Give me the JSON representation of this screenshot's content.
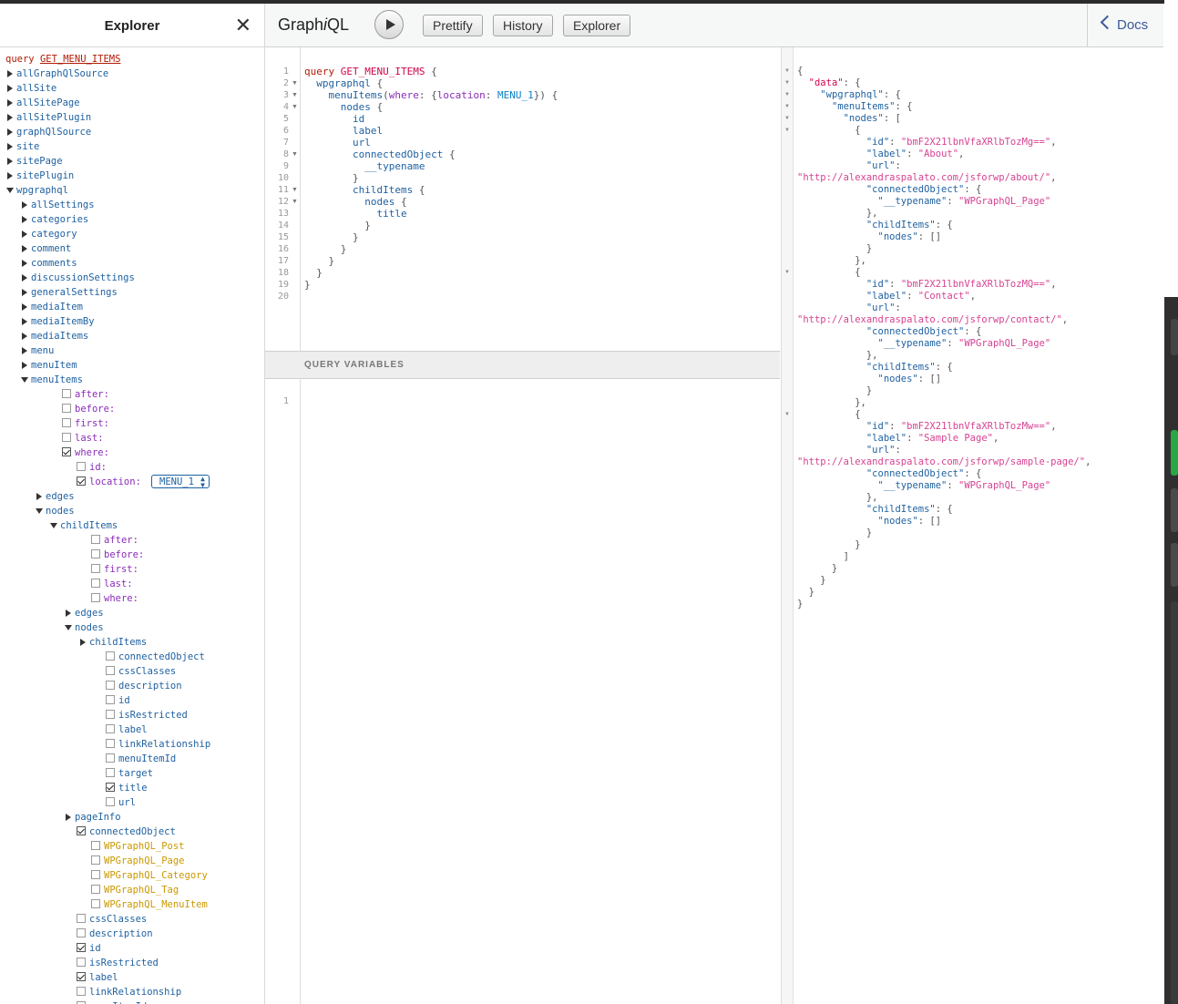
{
  "explorer": {
    "title": "Explorer",
    "query_keyword": "query",
    "operation_name": "GET_MENU_ITEMS",
    "tree": [
      {
        "label": "allGraphQlSource",
        "kind": "field",
        "ctrl": "arrow-right",
        "depth": 0
      },
      {
        "label": "allSite",
        "kind": "field",
        "ctrl": "arrow-right",
        "depth": 0
      },
      {
        "label": "allSitePage",
        "kind": "field",
        "ctrl": "arrow-right",
        "depth": 0
      },
      {
        "label": "allSitePlugin",
        "kind": "field",
        "ctrl": "arrow-right",
        "depth": 0
      },
      {
        "label": "graphQlSource",
        "kind": "field",
        "ctrl": "arrow-right",
        "depth": 0
      },
      {
        "label": "site",
        "kind": "field",
        "ctrl": "arrow-right",
        "depth": 0
      },
      {
        "label": "sitePage",
        "kind": "field",
        "ctrl": "arrow-right",
        "depth": 0
      },
      {
        "label": "sitePlugin",
        "kind": "field",
        "ctrl": "arrow-right",
        "depth": 0
      },
      {
        "label": "wpgraphql",
        "kind": "field",
        "ctrl": "arrow-down",
        "depth": 0
      },
      {
        "label": "allSettings",
        "kind": "field",
        "ctrl": "arrow-right",
        "depth": 1
      },
      {
        "label": "categories",
        "kind": "field",
        "ctrl": "arrow-right",
        "depth": 1
      },
      {
        "label": "category",
        "kind": "field",
        "ctrl": "arrow-right",
        "depth": 1
      },
      {
        "label": "comment",
        "kind": "field",
        "ctrl": "arrow-right",
        "depth": 1
      },
      {
        "label": "comments",
        "kind": "field",
        "ctrl": "arrow-right",
        "depth": 1
      },
      {
        "label": "discussionSettings",
        "kind": "field",
        "ctrl": "arrow-right",
        "depth": 1
      },
      {
        "label": "generalSettings",
        "kind": "field",
        "ctrl": "arrow-right",
        "depth": 1
      },
      {
        "label": "mediaItem",
        "kind": "field",
        "ctrl": "arrow-right",
        "depth": 1
      },
      {
        "label": "mediaItemBy",
        "kind": "field",
        "ctrl": "arrow-right",
        "depth": 1
      },
      {
        "label": "mediaItems",
        "kind": "field",
        "ctrl": "arrow-right",
        "depth": 1
      },
      {
        "label": "menu",
        "kind": "field",
        "ctrl": "arrow-right",
        "depth": 1
      },
      {
        "label": "menuItem",
        "kind": "field",
        "ctrl": "arrow-right",
        "depth": 1
      },
      {
        "label": "menuItems",
        "kind": "field",
        "ctrl": "arrow-down",
        "depth": 1
      },
      {
        "label": "after:",
        "kind": "arg",
        "ctrl": "cb",
        "depth": 2
      },
      {
        "label": "before:",
        "kind": "arg",
        "ctrl": "cb",
        "depth": 2
      },
      {
        "label": "first:",
        "kind": "arg",
        "ctrl": "cb",
        "depth": 2
      },
      {
        "label": "last:",
        "kind": "arg",
        "ctrl": "cb",
        "depth": 2
      },
      {
        "label": "where:",
        "kind": "arg",
        "ctrl": "cb-checked",
        "depth": 2
      },
      {
        "label": "id:",
        "kind": "arg",
        "ctrl": "cb",
        "depth": 3
      },
      {
        "label": "location:",
        "kind": "arg",
        "ctrl": "cb-checked",
        "depth": 3,
        "select": "MENU_1"
      },
      {
        "label": "edges",
        "kind": "field",
        "ctrl": "arrow-right",
        "depth": 2
      },
      {
        "label": "nodes",
        "kind": "field",
        "ctrl": "arrow-down",
        "depth": 2
      },
      {
        "label": "childItems",
        "kind": "field",
        "ctrl": "arrow-down",
        "depth": 3
      },
      {
        "label": "after:",
        "kind": "arg",
        "ctrl": "cb",
        "depth": 4
      },
      {
        "label": "before:",
        "kind": "arg",
        "ctrl": "cb",
        "depth": 4
      },
      {
        "label": "first:",
        "kind": "arg",
        "ctrl": "cb",
        "depth": 4
      },
      {
        "label": "last:",
        "kind": "arg",
        "ctrl": "cb",
        "depth": 4
      },
      {
        "label": "where:",
        "kind": "arg",
        "ctrl": "cb",
        "depth": 4
      },
      {
        "label": "edges",
        "kind": "field",
        "ctrl": "arrow-right",
        "depth": 4
      },
      {
        "label": "nodes",
        "kind": "field",
        "ctrl": "arrow-down",
        "depth": 4
      },
      {
        "label": "childItems",
        "kind": "field",
        "ctrl": "arrow-right",
        "depth": 5
      },
      {
        "label": "connectedObject",
        "kind": "field",
        "ctrl": "cb",
        "depth": 5
      },
      {
        "label": "cssClasses",
        "kind": "field",
        "ctrl": "cb",
        "depth": 5
      },
      {
        "label": "description",
        "kind": "field",
        "ctrl": "cb",
        "depth": 5
      },
      {
        "label": "id",
        "kind": "field",
        "ctrl": "cb",
        "depth": 5
      },
      {
        "label": "isRestricted",
        "kind": "field",
        "ctrl": "cb",
        "depth": 5
      },
      {
        "label": "label",
        "kind": "field",
        "ctrl": "cb",
        "depth": 5
      },
      {
        "label": "linkRelationship",
        "kind": "field",
        "ctrl": "cb",
        "depth": 5
      },
      {
        "label": "menuItemId",
        "kind": "field",
        "ctrl": "cb",
        "depth": 5
      },
      {
        "label": "target",
        "kind": "field",
        "ctrl": "cb",
        "depth": 5
      },
      {
        "label": "title",
        "kind": "field",
        "ctrl": "cb-checked",
        "depth": 5
      },
      {
        "label": "url",
        "kind": "field",
        "ctrl": "cb",
        "depth": 5
      },
      {
        "label": "pageInfo",
        "kind": "field",
        "ctrl": "arrow-right",
        "depth": 4
      },
      {
        "label": "connectedObject",
        "kind": "field",
        "ctrl": "cb-checked",
        "depth": 3
      },
      {
        "label": "WPGraphQL_Post",
        "kind": "type",
        "ctrl": "cb",
        "depth": 4
      },
      {
        "label": "WPGraphQL_Page",
        "kind": "type",
        "ctrl": "cb",
        "depth": 4
      },
      {
        "label": "WPGraphQL_Category",
        "kind": "type",
        "ctrl": "cb",
        "depth": 4
      },
      {
        "label": "WPGraphQL_Tag",
        "kind": "type",
        "ctrl": "cb",
        "depth": 4
      },
      {
        "label": "WPGraphQL_MenuItem",
        "kind": "type",
        "ctrl": "cb",
        "depth": 4
      },
      {
        "label": "cssClasses",
        "kind": "field",
        "ctrl": "cb",
        "depth": 3
      },
      {
        "label": "description",
        "kind": "field",
        "ctrl": "cb",
        "depth": 3
      },
      {
        "label": "id",
        "kind": "field",
        "ctrl": "cb-checked",
        "depth": 3
      },
      {
        "label": "isRestricted",
        "kind": "field",
        "ctrl": "cb",
        "depth": 3
      },
      {
        "label": "label",
        "kind": "field",
        "ctrl": "cb-checked",
        "depth": 3
      },
      {
        "label": "linkRelationship",
        "kind": "field",
        "ctrl": "cb",
        "depth": 3
      },
      {
        "label": "menuItemId",
        "kind": "field",
        "ctrl": "cb",
        "depth": 3
      }
    ]
  },
  "toolbar": {
    "logo_pre": "Graph",
    "logo_i": "i",
    "logo_post": "QL",
    "prettify": "Prettify",
    "history": "History",
    "explorer": "Explorer",
    "docs": "Docs"
  },
  "editor": {
    "line_numbers": [
      "1",
      "2",
      "3",
      "4",
      "5",
      "6",
      "7",
      "8",
      "9",
      "10",
      "11",
      "12",
      "13",
      "14",
      "15",
      "16",
      "17",
      "18",
      "19",
      "20"
    ],
    "query_variables_label": "QUERY VARIABLES",
    "variables_line": "1",
    "code": [
      [
        [
          "c-kw",
          "query "
        ],
        [
          "c-def",
          "GET_MENU_ITEMS"
        ],
        [
          "c-p",
          " {"
        ]
      ],
      [
        [
          "c-p",
          "  "
        ],
        [
          "c-prop",
          "wpgraphql"
        ],
        [
          "c-p",
          " {"
        ]
      ],
      [
        [
          "c-p",
          "    "
        ],
        [
          "c-prop",
          "menuItems"
        ],
        [
          "c-p",
          "("
        ],
        [
          "c-attr",
          "where"
        ],
        [
          "c-p",
          ": {"
        ],
        [
          "c-attr",
          "location"
        ],
        [
          "c-p",
          ": "
        ],
        [
          "c-val",
          "MENU_1"
        ],
        [
          "c-p",
          "}) {"
        ]
      ],
      [
        [
          "c-p",
          "      "
        ],
        [
          "c-prop",
          "nodes"
        ],
        [
          "c-p",
          " {"
        ]
      ],
      [
        [
          "c-p",
          "        "
        ],
        [
          "c-prop",
          "id"
        ]
      ],
      [
        [
          "c-p",
          "        "
        ],
        [
          "c-prop",
          "label"
        ]
      ],
      [
        [
          "c-p",
          "        "
        ],
        [
          "c-prop",
          "url"
        ]
      ],
      [
        [
          "c-p",
          "        "
        ],
        [
          "c-prop",
          "connectedObject"
        ],
        [
          "c-p",
          " {"
        ]
      ],
      [
        [
          "c-p",
          "          "
        ],
        [
          "c-prop",
          "__typename"
        ]
      ],
      [
        [
          "c-p",
          "        }"
        ]
      ],
      [
        [
          "c-p",
          "        "
        ],
        [
          "c-prop",
          "childItems"
        ],
        [
          "c-p",
          " {"
        ]
      ],
      [
        [
          "c-p",
          "          "
        ],
        [
          "c-prop",
          "nodes"
        ],
        [
          "c-p",
          " {"
        ]
      ],
      [
        [
          "c-p",
          "            "
        ],
        [
          "c-prop",
          "title"
        ]
      ],
      [
        [
          "c-p",
          "          }"
        ]
      ],
      [
        [
          "c-p",
          "        }"
        ]
      ],
      [
        [
          "c-p",
          "      }"
        ]
      ],
      [
        [
          "c-p",
          "    }"
        ]
      ],
      [
        [
          "c-p",
          "  }"
        ]
      ],
      [
        [
          "c-p",
          "}"
        ]
      ],
      [
        [
          "c-p",
          ""
        ]
      ]
    ]
  },
  "result": {
    "lines": [
      [
        [
          "r-p",
          "{"
        ]
      ],
      [
        [
          "r-p",
          "  "
        ],
        [
          "r-dkey",
          "\"data\""
        ],
        [
          "r-p",
          ": {"
        ]
      ],
      [
        [
          "r-p",
          "    "
        ],
        [
          "r-key",
          "\"wpgraphql\""
        ],
        [
          "r-p",
          ": {"
        ]
      ],
      [
        [
          "r-p",
          "      "
        ],
        [
          "r-key",
          "\"menuItems\""
        ],
        [
          "r-p",
          ": {"
        ]
      ],
      [
        [
          "r-p",
          "        "
        ],
        [
          "r-key",
          "\"nodes\""
        ],
        [
          "r-p",
          ": ["
        ]
      ],
      [
        [
          "r-p",
          "          {"
        ]
      ],
      [
        [
          "r-p",
          "            "
        ],
        [
          "r-key",
          "\"id\""
        ],
        [
          "r-p",
          ": "
        ],
        [
          "r-str",
          "\"bmF2X21lbnVfaXRlbTozMg==\""
        ],
        [
          "r-p",
          ","
        ]
      ],
      [
        [
          "r-p",
          "            "
        ],
        [
          "r-key",
          "\"label\""
        ],
        [
          "r-p",
          ": "
        ],
        [
          "r-str",
          "\"About\""
        ],
        [
          "r-p",
          ","
        ]
      ],
      [
        [
          "r-p",
          "            "
        ],
        [
          "r-key",
          "\"url\""
        ],
        [
          "r-p",
          ":"
        ]
      ],
      [
        [
          "r-str",
          "\"http://alexandraspalato.com/jsforwp/about/\""
        ],
        [
          "r-p",
          ","
        ]
      ],
      [
        [
          "r-p",
          "            "
        ],
        [
          "r-key",
          "\"connectedObject\""
        ],
        [
          "r-p",
          ": {"
        ]
      ],
      [
        [
          "r-p",
          "              "
        ],
        [
          "r-key",
          "\"__typename\""
        ],
        [
          "r-p",
          ": "
        ],
        [
          "r-str",
          "\"WPGraphQL_Page\""
        ]
      ],
      [
        [
          "r-p",
          "            },"
        ]
      ],
      [
        [
          "r-p",
          "            "
        ],
        [
          "r-key",
          "\"childItems\""
        ],
        [
          "r-p",
          ": {"
        ]
      ],
      [
        [
          "r-p",
          "              "
        ],
        [
          "r-key",
          "\"nodes\""
        ],
        [
          "r-p",
          ": []"
        ]
      ],
      [
        [
          "r-p",
          "            }"
        ]
      ],
      [
        [
          "r-p",
          "          },"
        ]
      ],
      [
        [
          "r-p",
          "          {"
        ]
      ],
      [
        [
          "r-p",
          "            "
        ],
        [
          "r-key",
          "\"id\""
        ],
        [
          "r-p",
          ": "
        ],
        [
          "r-str",
          "\"bmF2X21lbnVfaXRlbTozMQ==\""
        ],
        [
          "r-p",
          ","
        ]
      ],
      [
        [
          "r-p",
          "            "
        ],
        [
          "r-key",
          "\"label\""
        ],
        [
          "r-p",
          ": "
        ],
        [
          "r-str",
          "\"Contact\""
        ],
        [
          "r-p",
          ","
        ]
      ],
      [
        [
          "r-p",
          "            "
        ],
        [
          "r-key",
          "\"url\""
        ],
        [
          "r-p",
          ":"
        ]
      ],
      [
        [
          "r-str",
          "\"http://alexandraspalato.com/jsforwp/contact/\""
        ],
        [
          "r-p",
          ","
        ]
      ],
      [
        [
          "r-p",
          "            "
        ],
        [
          "r-key",
          "\"connectedObject\""
        ],
        [
          "r-p",
          ": {"
        ]
      ],
      [
        [
          "r-p",
          "              "
        ],
        [
          "r-key",
          "\"__typename\""
        ],
        [
          "r-p",
          ": "
        ],
        [
          "r-str",
          "\"WPGraphQL_Page\""
        ]
      ],
      [
        [
          "r-p",
          "            },"
        ]
      ],
      [
        [
          "r-p",
          "            "
        ],
        [
          "r-key",
          "\"childItems\""
        ],
        [
          "r-p",
          ": {"
        ]
      ],
      [
        [
          "r-p",
          "              "
        ],
        [
          "r-key",
          "\"nodes\""
        ],
        [
          "r-p",
          ": []"
        ]
      ],
      [
        [
          "r-p",
          "            }"
        ]
      ],
      [
        [
          "r-p",
          "          },"
        ]
      ],
      [
        [
          "r-p",
          "          {"
        ]
      ],
      [
        [
          "r-p",
          "            "
        ],
        [
          "r-key",
          "\"id\""
        ],
        [
          "r-p",
          ": "
        ],
        [
          "r-str",
          "\"bmF2X21lbnVfaXRlbTozMw==\""
        ],
        [
          "r-p",
          ","
        ]
      ],
      [
        [
          "r-p",
          "            "
        ],
        [
          "r-key",
          "\"label\""
        ],
        [
          "r-p",
          ": "
        ],
        [
          "r-str",
          "\"Sample Page\""
        ],
        [
          "r-p",
          ","
        ]
      ],
      [
        [
          "r-p",
          "            "
        ],
        [
          "r-key",
          "\"url\""
        ],
        [
          "r-p",
          ":"
        ]
      ],
      [
        [
          "r-str",
          "\"http://alexandraspalato.com/jsforwp/sample-page/\""
        ],
        [
          "r-p",
          ","
        ]
      ],
      [
        [
          "r-p",
          "            "
        ],
        [
          "r-key",
          "\"connectedObject\""
        ],
        [
          "r-p",
          ": {"
        ]
      ],
      [
        [
          "r-p",
          "              "
        ],
        [
          "r-key",
          "\"__typename\""
        ],
        [
          "r-p",
          ": "
        ],
        [
          "r-str",
          "\"WPGraphQL_Page\""
        ]
      ],
      [
        [
          "r-p",
          "            },"
        ]
      ],
      [
        [
          "r-p",
          "            "
        ],
        [
          "r-key",
          "\"childItems\""
        ],
        [
          "r-p",
          ": {"
        ]
      ],
      [
        [
          "r-p",
          "              "
        ],
        [
          "r-key",
          "\"nodes\""
        ],
        [
          "r-p",
          ": []"
        ]
      ],
      [
        [
          "r-p",
          "            }"
        ]
      ],
      [
        [
          "r-p",
          "          }"
        ]
      ],
      [
        [
          "r-p",
          "        ]"
        ]
      ],
      [
        [
          "r-p",
          "      }"
        ]
      ],
      [
        [
          "r-p",
          "    }"
        ]
      ],
      [
        [
          "r-p",
          "  }"
        ]
      ],
      [
        [
          "r-p",
          "}"
        ]
      ]
    ]
  },
  "colors": {
    "field": "#1f61a0",
    "arg": "#8b2bb9",
    "type": "#ca9800",
    "keyword": "#b11a04",
    "string": "#d64292",
    "docs_link": "#3b5998"
  }
}
